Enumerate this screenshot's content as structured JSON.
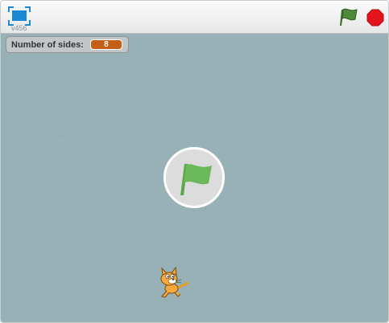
{
  "toolbar": {
    "version": "v456",
    "fullscreen_icon": "fullscreen-icon",
    "green_flag_icon": "green-flag-icon",
    "stop_icon": "stop-sign-icon"
  },
  "stage": {
    "monitor": {
      "label": "Number of sides:",
      "value": "8"
    },
    "overlay_icon": "green-flag-icon",
    "sprite": "cat-sprite"
  },
  "colors": {
    "stage_background": "#97b1b6",
    "monitor_value_background": "#c35f17",
    "flag_green": "#4caf50",
    "stop_red": "#e3141b",
    "fullscreen_blue": "#1b88d6"
  }
}
